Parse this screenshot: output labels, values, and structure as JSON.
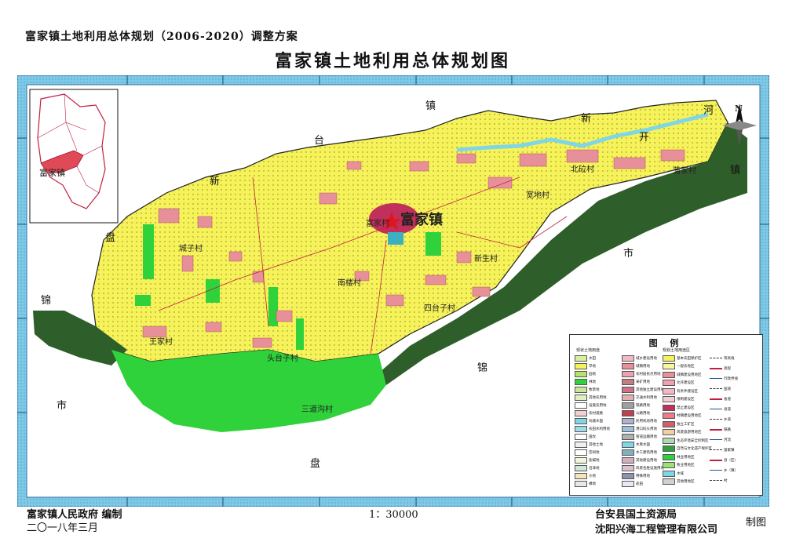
{
  "header": {
    "subtitle": "富家镇土地利用总体规划（2006-2020）调整方案",
    "title": "富家镇土地利用总体规划图"
  },
  "map": {
    "town_name": "富家镇",
    "center_village": "富家村",
    "inset_label": "富家镇",
    "neighbors": {
      "zhen": "镇",
      "tai": "台",
      "xin": "新",
      "pan_left": "盘",
      "jin_left": "锦",
      "shi_left": "市",
      "he": "河",
      "xin_right": "新",
      "kai": "开",
      "zhen_right": "镇",
      "shi_right": "市",
      "jin_bottom": "锦",
      "pan_bottom": "盘"
    },
    "villages": [
      {
        "name": "北砬村"
      },
      {
        "name": "蒲家村"
      },
      {
        "name": "宽地村"
      },
      {
        "name": "新生村"
      },
      {
        "name": "四台子村"
      },
      {
        "name": "南楼村"
      },
      {
        "name": "城子村"
      },
      {
        "name": "王家村"
      },
      {
        "name": "头台子村"
      },
      {
        "name": "三道沟村"
      }
    ],
    "north_arrow": "N",
    "colors": {
      "land_yellow": "#f6f25a",
      "forest_green": "#2fd23a",
      "dark_green": "#2e5f2a",
      "settlement_pink": "#e7909a",
      "town_red": "#c0305a",
      "water": "#7fd6e6",
      "border_blue": "#7fc9e8"
    }
  },
  "legend": {
    "title": "图  例",
    "left_header": "现状土地用途",
    "mid_header": "规划土地用途区",
    "items_left": [
      "水田",
      "旱地",
      "园地",
      "林地",
      "牧草地",
      "其他农用地",
      "设施农用地",
      "农村道路",
      "坑塘水面",
      "农田水利用地",
      "田坎",
      "其他土地",
      "空闲地",
      "盐碱地",
      "沼泽地",
      "沙地",
      "裸地"
    ],
    "items_mid": [
      "城乡建设用地",
      "城镇用地",
      "农村居民点用地",
      "采矿用地",
      "其他独立建设用地",
      "交通水利用地",
      "铁路用地",
      "公路用地",
      "民用机场用地",
      "港口码头用地",
      "管道运输用地",
      "水库水面",
      "水工建筑用地",
      "其他建设用地",
      "风景名胜设施用地",
      "特殊用地",
      "盐田"
    ],
    "items_right": [
      "基本农田保护区",
      "一般农地区",
      "城镇建设用地区",
      "允许建设区",
      "有条件建设区",
      "限制建设区",
      "禁止建设区",
      "村镇建设用地区",
      "独立工矿区",
      "风景旅游用地区",
      "生态环境安全控制区",
      "自然与文化遗产保护区",
      "林业用地区",
      "牧业用地区",
      "水域",
      "其他用地区"
    ],
    "items_symbols": [
      "等高线",
      "高程",
      "行政界线",
      "国道",
      "省道",
      "县道",
      "乡道",
      "铁路",
      "河流",
      "富家镇",
      "县（区）",
      "乡（镇）",
      "村"
    ]
  },
  "footer": {
    "left_org": "富家镇人民政府   编制",
    "left_date": "二〇一八年三月",
    "scale": "1：30000",
    "right_org1": "台安县国土资源局",
    "right_org2": "沈阳兴海工程管理有限公司",
    "right_tag": "制图"
  }
}
